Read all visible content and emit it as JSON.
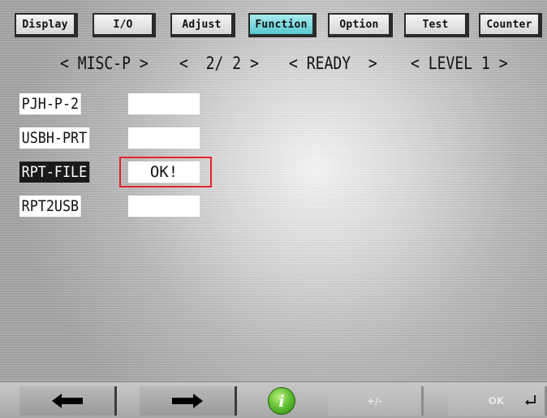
{
  "tabs": [
    {
      "label": "Display"
    },
    {
      "label": "I/O"
    },
    {
      "label": "Adjust"
    },
    {
      "label": "Function"
    },
    {
      "label": "Option"
    },
    {
      "label": "Test"
    },
    {
      "label": "Counter"
    }
  ],
  "active_tab": "Function",
  "header": {
    "mode": "< MISC-P >",
    "page": "<  2/ 2 >",
    "state": "< READY  >",
    "level": "< LEVEL 1 >"
  },
  "rows": [
    {
      "label": "PJH-P-2",
      "value": "",
      "selected": false
    },
    {
      "label": "USBH-PRT",
      "value": "",
      "selected": false
    },
    {
      "label": "RPT-FILE",
      "value": "OK!",
      "selected": true
    },
    {
      "label": "RPT2USB",
      "value": "",
      "selected": false
    }
  ],
  "bottom": {
    "prev_icon": "arrow-left-icon",
    "next_icon": "arrow-right-icon",
    "info_icon": "info-icon",
    "info_glyph": "i",
    "plusminus_label": "+/-",
    "ok_label": "OK",
    "enter_icon": "enter-icon"
  },
  "colors": {
    "active_tab": "#57c8cf",
    "highlight_box": "#e0212b",
    "selected_label_bg": "#1a1a1a",
    "info_icon": "#58b82c"
  }
}
